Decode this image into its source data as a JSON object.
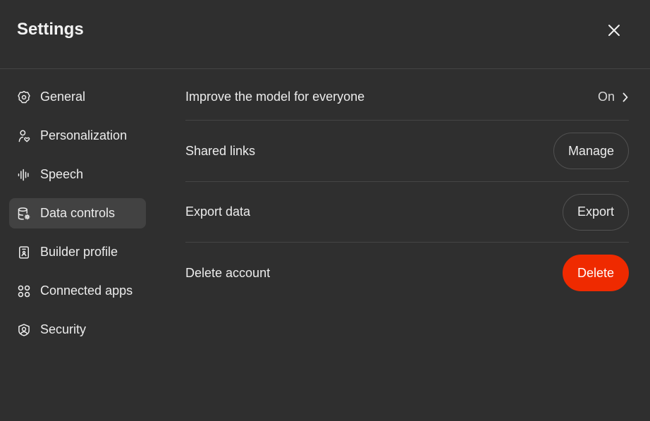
{
  "header": {
    "title": "Settings",
    "close_icon": "close-icon"
  },
  "sidebar": {
    "active": "Data controls",
    "items": [
      {
        "label": "General",
        "icon": "gear-icon"
      },
      {
        "label": "Personalization",
        "icon": "person-heart-icon"
      },
      {
        "label": "Speech",
        "icon": "sound-wave-icon"
      },
      {
        "label": "Data controls",
        "icon": "database-gear-icon"
      },
      {
        "label": "Builder profile",
        "icon": "id-badge-icon"
      },
      {
        "label": "Connected apps",
        "icon": "apps-grid-icon"
      },
      {
        "label": "Security",
        "icon": "shield-user-icon"
      }
    ]
  },
  "content": {
    "rows": [
      {
        "label": "Improve the model for everyone",
        "value": "On",
        "icon": "chevron-right-icon"
      },
      {
        "label": "Shared links",
        "button": "Manage"
      },
      {
        "label": "Export data",
        "button": "Export"
      },
      {
        "label": "Delete account",
        "button": "Delete"
      }
    ]
  },
  "colors": {
    "background": "#2f2f2f",
    "active_item": "#424242",
    "divider": "#444444",
    "danger": "#ef2a00",
    "text": "#ececec"
  }
}
